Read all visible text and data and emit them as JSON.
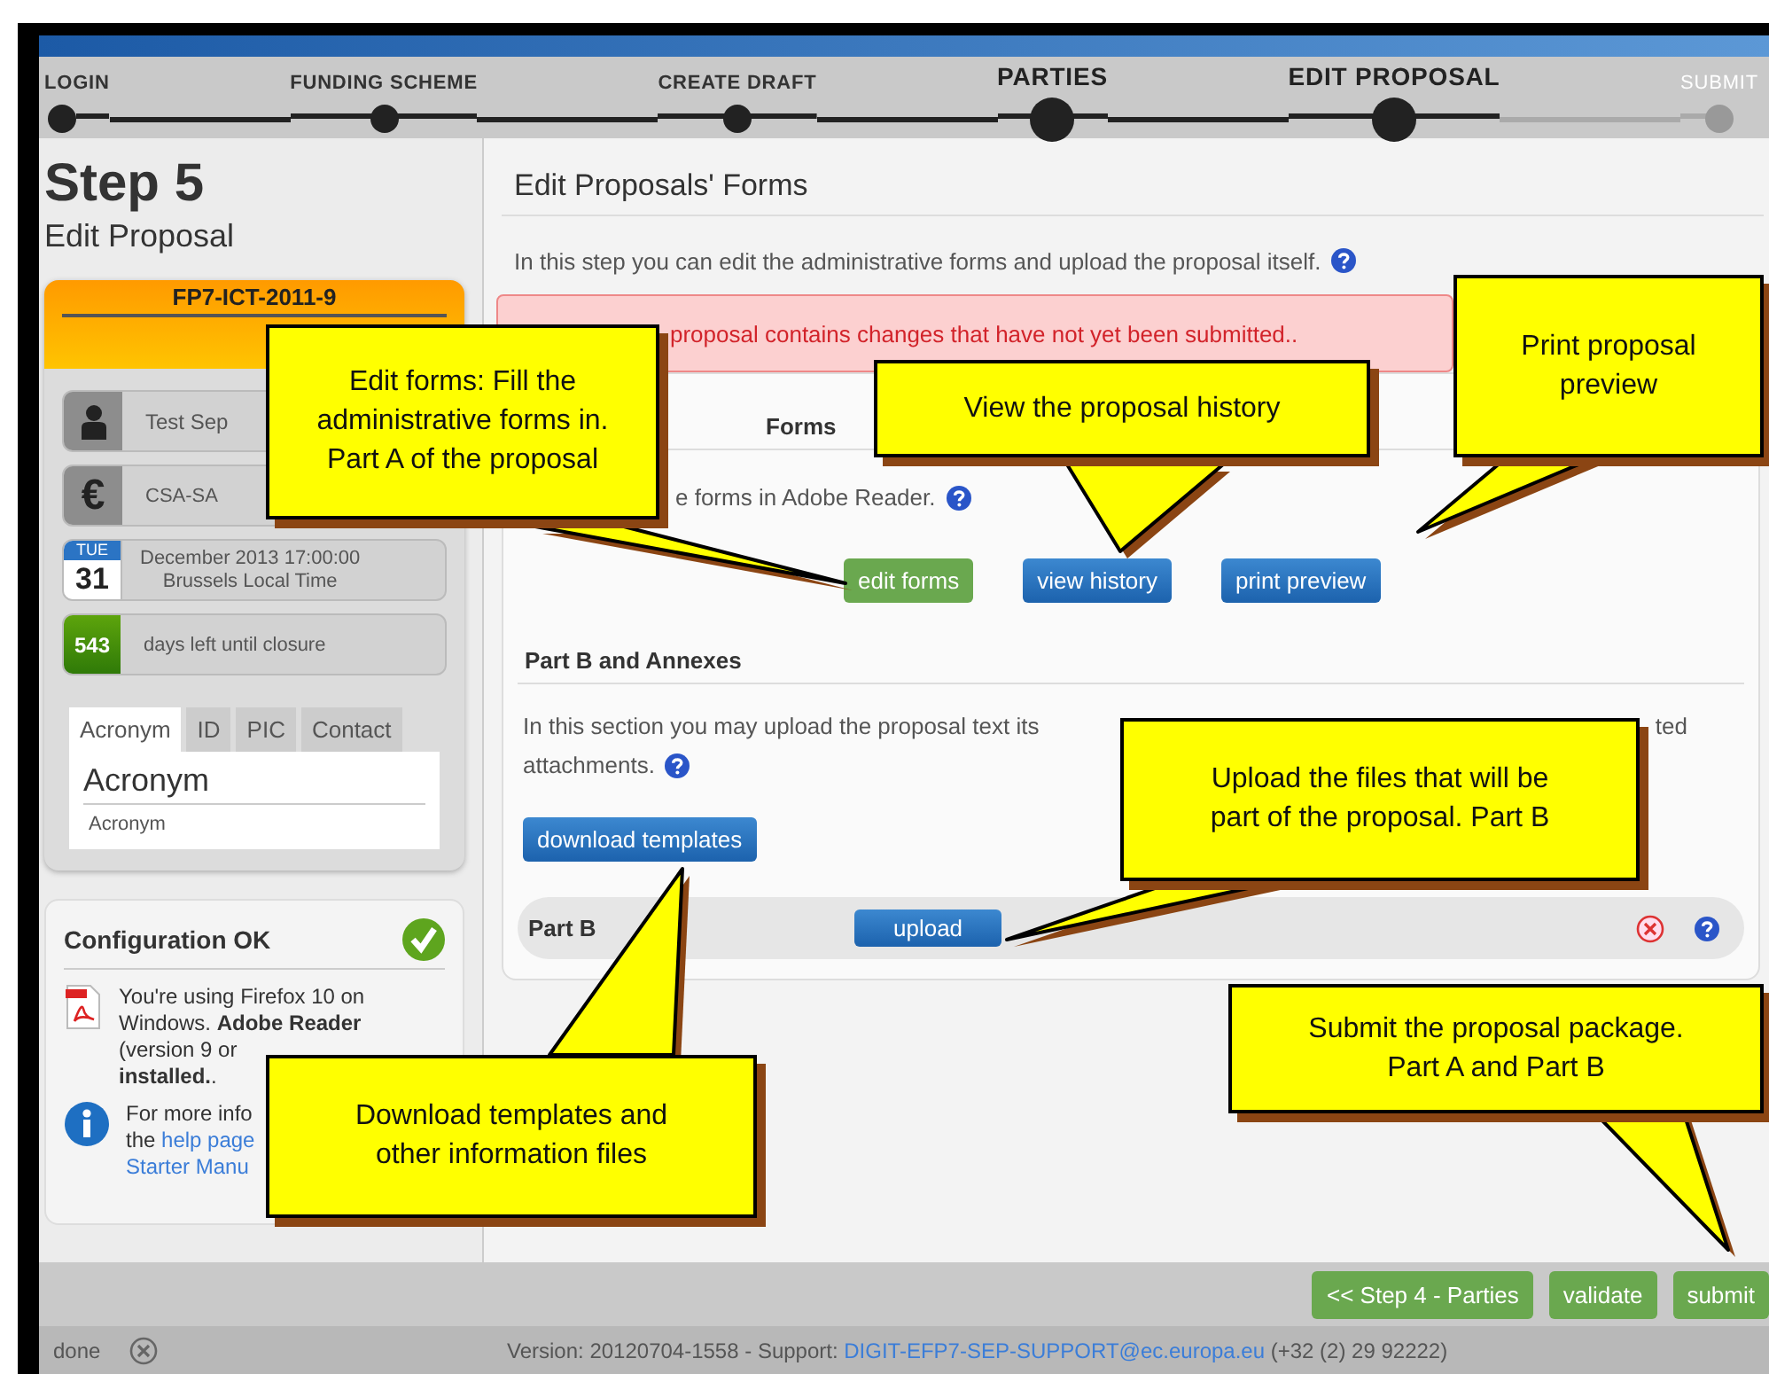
{
  "steps": [
    {
      "label": "LOGIN",
      "emphasized": false,
      "completed": true
    },
    {
      "label": "FUNDING SCHEME",
      "emphasized": false,
      "completed": true
    },
    {
      "label": "CREATE DRAFT",
      "emphasized": false,
      "completed": true
    },
    {
      "label": "PARTIES",
      "emphasized": true,
      "completed": true
    },
    {
      "label": "EDIT PROPOSAL",
      "emphasized": true,
      "completed": true
    },
    {
      "label": "SUBMIT",
      "emphasized": false,
      "completed": false
    }
  ],
  "sidebar": {
    "step_title": "Step 5",
    "step_subtitle": "Edit Proposal",
    "call": {
      "title": "FP7-ICT-2011-9",
      "rows": [
        {
          "kind": "person",
          "text": "Test Sep"
        },
        {
          "kind": "currency",
          "symbol": "€",
          "text": "CSA-SA"
        },
        {
          "kind": "calendar",
          "day": "TUE",
          "date": "31",
          "lines": [
            "December 2013 17:00:00",
            "Brussels Local Time"
          ]
        },
        {
          "kind": "countdown",
          "count": "543",
          "text": "days left until closure"
        }
      ]
    },
    "tabs": [
      {
        "label": "Acronym",
        "selected": true
      },
      {
        "label": "ID",
        "selected": false
      },
      {
        "label": "PIC",
        "selected": false
      },
      {
        "label": "Contact",
        "selected": false
      }
    ],
    "tab_content": {
      "title": "Acronym",
      "value": "Acronym"
    }
  },
  "configuration": {
    "title": "Configuration OK",
    "ok": true,
    "messages": [
      {
        "kind": "pdf",
        "lines": [
          [
            {
              "text": "You're using Firefox 10 on",
              "link": false
            }
          ],
          [
            {
              "text": "Windows. **Adobe Reader**",
              "link": false
            }
          ],
          [
            {
              "text": "(version 9 or",
              "link": false
            }
          ],
          [
            {
              "text": "**installed.**.",
              "link": false
            }
          ]
        ]
      },
      {
        "kind": "info",
        "lines": [
          [
            {
              "text": "For more info",
              "link": false
            }
          ],
          [
            {
              "text": "the ",
              "link": false
            },
            {
              "text": "help page",
              "link": true
            }
          ],
          [
            {
              "text": "Starter Manu",
              "link": true
            }
          ]
        ]
      }
    ]
  },
  "main": {
    "title": "Edit Proposals' Forms",
    "intro": "In this step you can edit the administrative forms and upload the proposal itself.",
    "alert": "proposal contains changes that have not yet been submitted..",
    "part_a": {
      "title": "Forms",
      "text": "e forms in Adobe Reader.",
      "buttons": [
        {
          "label": "edit forms",
          "kind": "success"
        },
        {
          "label": "view history",
          "kind": "primary"
        },
        {
          "label": "print preview",
          "kind": "primary"
        }
      ]
    },
    "part_b": {
      "title": "Part B and Annexes",
      "text_start": "In this section you may upload the proposal text its",
      "text_end": "ted",
      "text_second_line": "attachments.",
      "templates_button": "download templates",
      "file_row": {
        "label": "Part B",
        "button": "upload"
      }
    }
  },
  "footer": {
    "buttons": [
      {
        "label": "<< Step 4 - Parties"
      },
      {
        "label": "validate"
      },
      {
        "label": "submit"
      }
    ]
  },
  "status_bar": {
    "state": "done",
    "version": "Version: 20120704-1558 - Support:",
    "email": "DIGIT-EFP7-SEP-SUPPORT@ec.europa.eu",
    "phone": "(+32 (2) 29 92222)"
  },
  "callouts": [
    {
      "text": "Edit forms: Fill the administrative forms in. Part A of the proposal"
    },
    {
      "text": "View the proposal history"
    },
    {
      "text": "Print proposal preview"
    },
    {
      "text": "Upload the files that will be part of the proposal. Part B"
    },
    {
      "text": "Download templates and other information files"
    },
    {
      "text": "Submit the proposal package. Part A and Part B"
    }
  ]
}
